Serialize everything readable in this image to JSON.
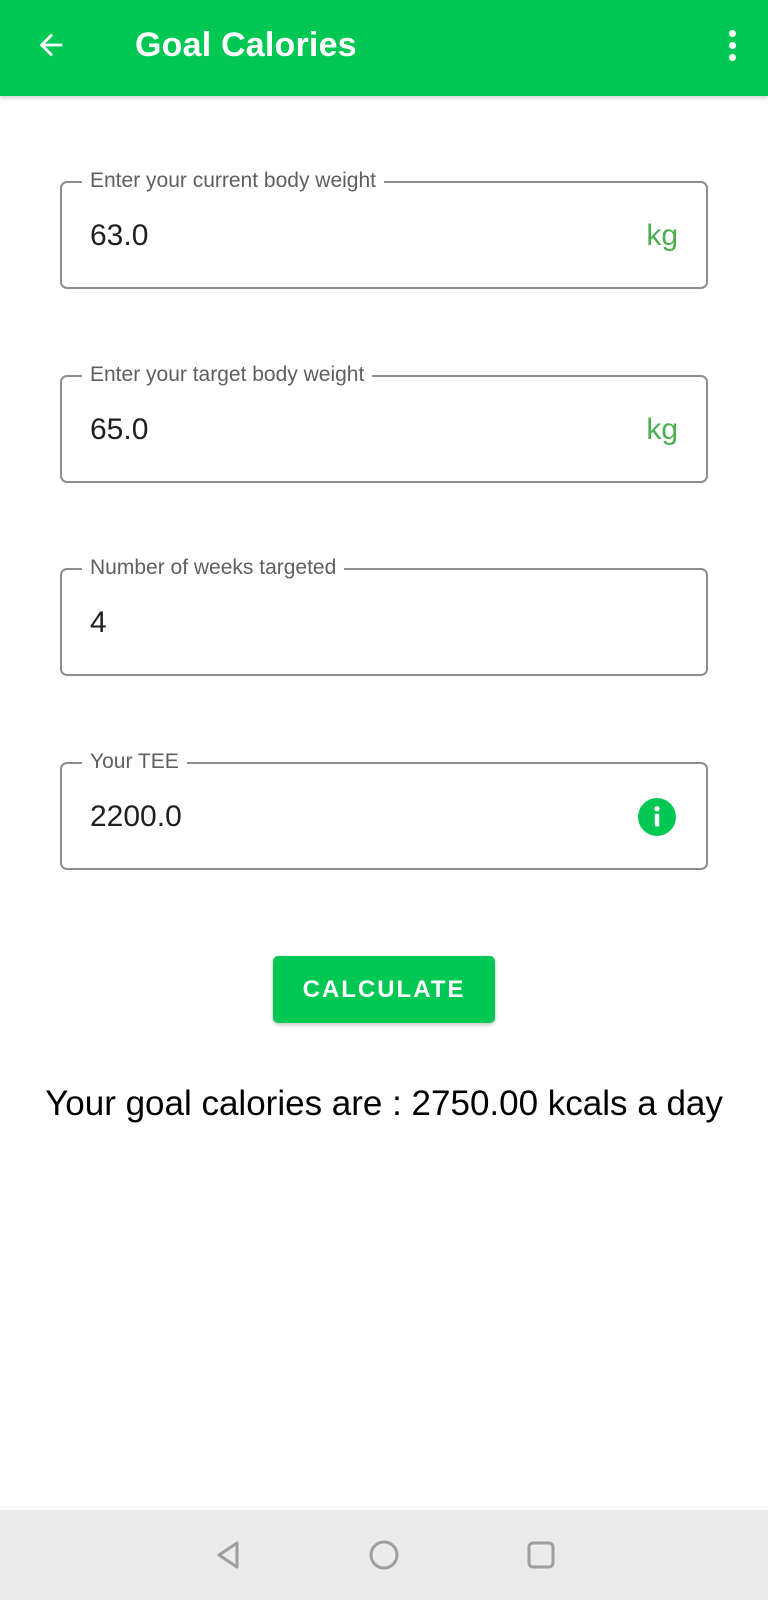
{
  "app_bar": {
    "title": "Goal Calories",
    "background_color": "#00c853",
    "back_icon": "arrow-left-icon",
    "menu_icon": "more-vertical-icon"
  },
  "fields": {
    "current_weight": {
      "label": "Enter your current body weight",
      "value": "63.0",
      "suffix": "kg"
    },
    "target_weight": {
      "label": "Enter your target body weight",
      "value": "65.0",
      "suffix": "kg"
    },
    "weeks": {
      "label": "Number of weeks targeted",
      "value": "4"
    },
    "tee": {
      "label": "Your TEE",
      "value": "2200.0",
      "trailing_icon": "info-icon"
    }
  },
  "calculate_button": {
    "label": "CALCULATE",
    "color": "#00c853"
  },
  "result": {
    "text": "Your goal calories are : 2750.00 kcals a day"
  },
  "system_nav": {
    "back_icon": "triangle-back-icon",
    "home_icon": "circle-home-icon",
    "recents_icon": "square-recents-icon"
  },
  "colors": {
    "accent": "#00c853",
    "suffix_text": "#4caf50",
    "field_border": "#8e8e8e",
    "nav_bar": "#ebebeb"
  }
}
